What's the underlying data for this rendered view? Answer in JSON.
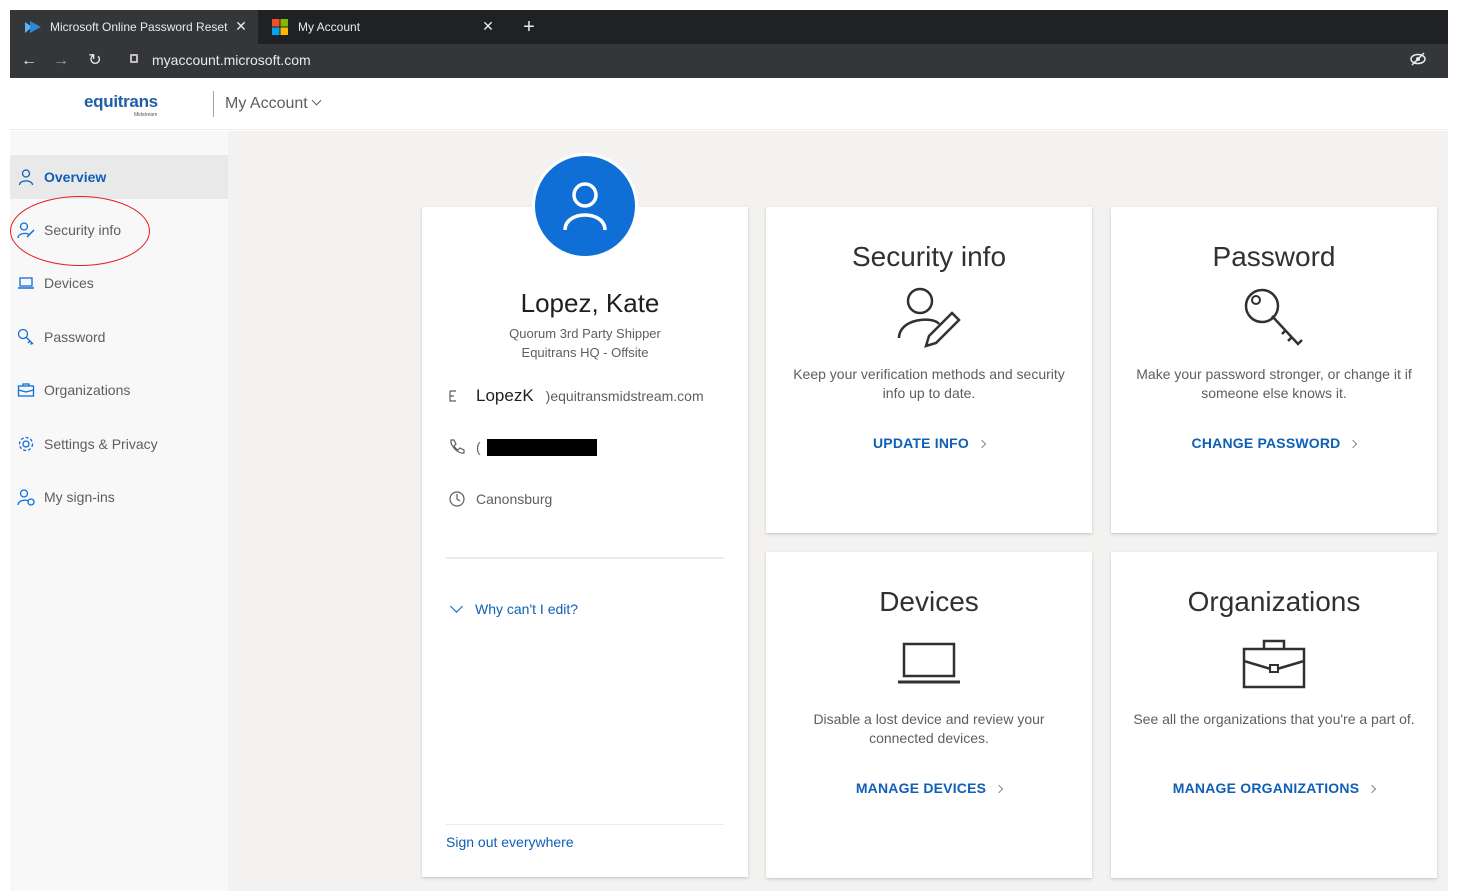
{
  "browser": {
    "tabs": [
      {
        "title": "Microsoft Online Password Reset",
        "favicon": "password-reset-icon",
        "active": true
      },
      {
        "title": "My Account",
        "favicon": "microsoft-logo-icon",
        "active": false
      }
    ],
    "url": "myaccount.microsoft.com"
  },
  "header": {
    "logo_text": "equitrans",
    "logo_subtext": "Midstream",
    "app_title": "My Account"
  },
  "sidebar": {
    "items": [
      {
        "label": "Overview",
        "icon": "person-icon",
        "active": true
      },
      {
        "label": "Security info",
        "icon": "person-key-icon",
        "active": false
      },
      {
        "label": "Devices",
        "icon": "laptop-icon",
        "active": false
      },
      {
        "label": "Password",
        "icon": "key-icon",
        "active": false
      },
      {
        "label": "Organizations",
        "icon": "briefcase-icon",
        "active": false
      },
      {
        "label": "Settings & Privacy",
        "icon": "gear-icon",
        "active": false
      },
      {
        "label": "My sign-ins",
        "icon": "person-sync-icon",
        "active": false
      }
    ]
  },
  "profile": {
    "name": "Lopez, Kate",
    "title": "Quorum 3rd Party Shipper",
    "office": "Equitrans HQ - Offsite",
    "email_user": "LopezK",
    "email_domain": ")equitransmidstream.com",
    "phone_prefix": "(",
    "location": "Canonsburg",
    "why_cant_edit": "Why can't I edit?",
    "sign_out": "Sign out everywhere"
  },
  "tiles": [
    {
      "title": "Security info",
      "icon": "person-pencil-icon",
      "description": "Keep your verification methods and security info up to date.",
      "link": "UPDATE INFO"
    },
    {
      "title": "Password",
      "icon": "key-icon",
      "description": "Make your password stronger, or change it if someone else knows it.",
      "link": "CHANGE PASSWORD"
    },
    {
      "title": "Devices",
      "icon": "laptop-icon",
      "description": "Disable a lost device and review your connected devices.",
      "link": "MANAGE DEVICES"
    },
    {
      "title": "Organizations",
      "icon": "briefcase-icon",
      "description": "See all the organizations that you're a part of.",
      "link": "MANAGE ORGANIZATIONS"
    }
  ],
  "colors": {
    "accent": "#0f5fb5",
    "avatar": "#0f6fd6",
    "annotation": "#e02020"
  }
}
